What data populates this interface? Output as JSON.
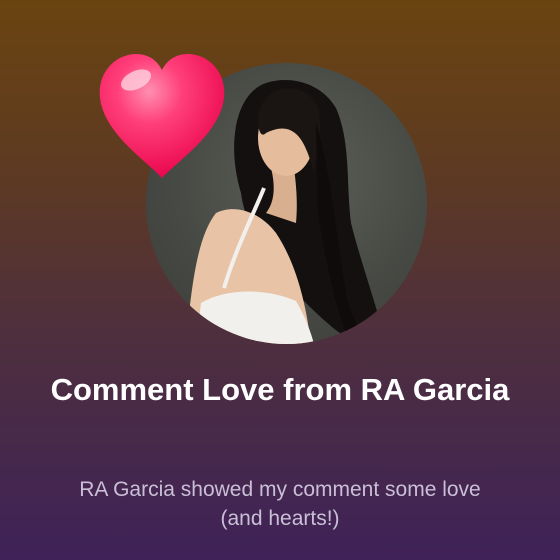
{
  "notification": {
    "title": "Comment Love from RA Garcia",
    "message": "RA Garcia showed my comment some love (and hearts!)",
    "avatar_icon": "profile-photo",
    "reaction_icon": "heart-icon"
  },
  "colors": {
    "background_top": "#6a4410",
    "background_bottom": "#3f2258",
    "title": "#ffffff",
    "message": "#c9bfd6",
    "heart": "#ff2a6b"
  }
}
